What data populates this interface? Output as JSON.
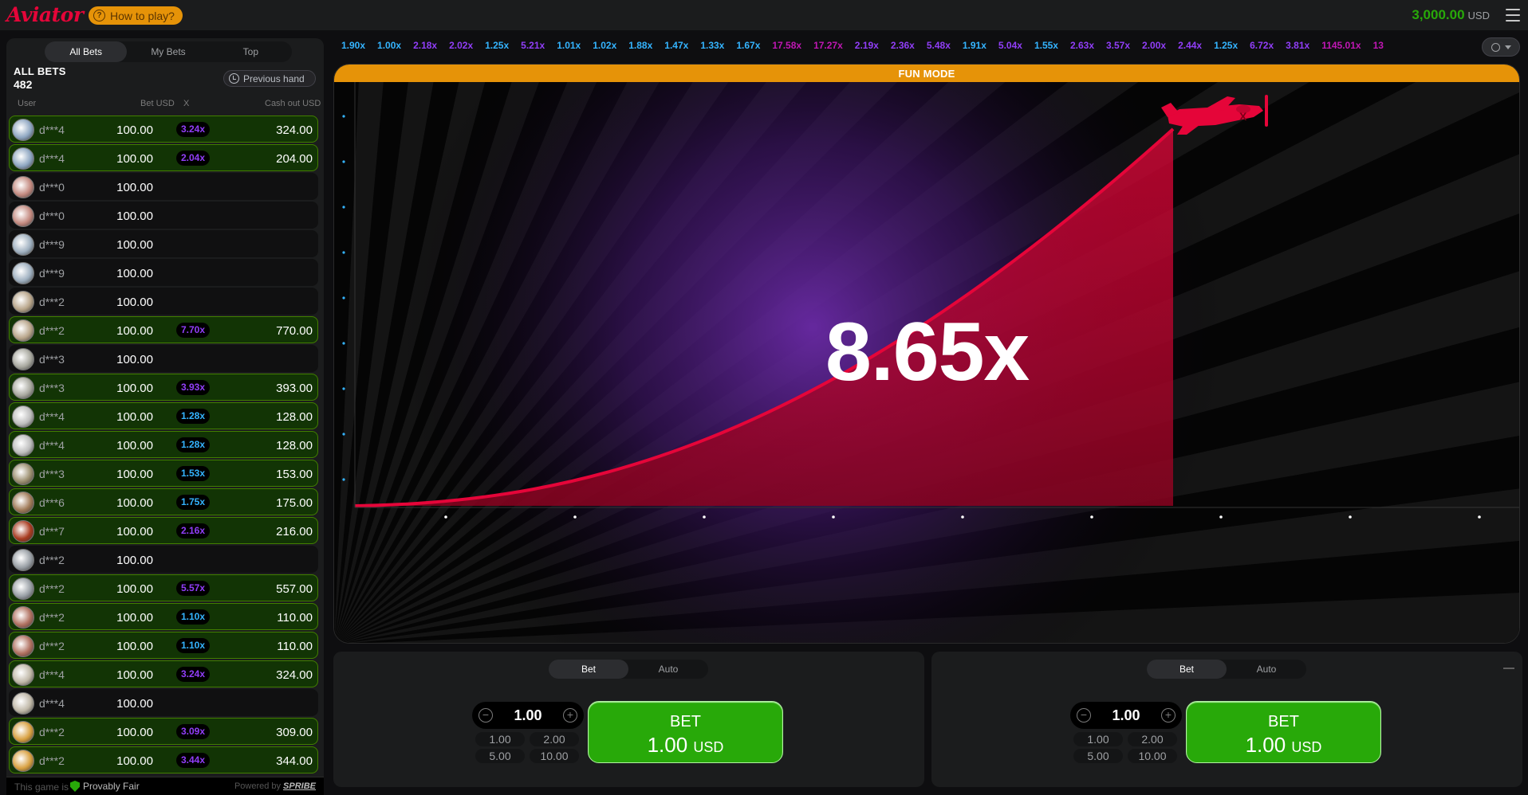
{
  "header": {
    "logo": "Aviator",
    "how_to_play": "How to play?",
    "balance_amount": "3,000.00",
    "balance_currency": "USD"
  },
  "left_panel": {
    "tabs": [
      "All Bets",
      "My Bets",
      "Top"
    ],
    "active_tab": 0,
    "title": "ALL BETS",
    "count": "482",
    "previous_hand": "Previous hand",
    "columns": {
      "user": "User",
      "bet": "Bet USD",
      "x": "X",
      "cashout": "Cash out USD"
    },
    "rows": [
      {
        "user": "d***4",
        "bet": "100.00",
        "mult": "3.24x",
        "mult_color": "purple",
        "cashout": "324.00",
        "avatar": "#8fa7c2"
      },
      {
        "user": "d***4",
        "bet": "100.00",
        "mult": "2.04x",
        "mult_color": "purple",
        "cashout": "204.00",
        "avatar": "#8fa7c2"
      },
      {
        "user": "d***0",
        "bet": "100.00",
        "mult": "",
        "mult_color": "",
        "cashout": "",
        "avatar": "#c48a80"
      },
      {
        "user": "d***0",
        "bet": "100.00",
        "mult": "",
        "mult_color": "",
        "cashout": "",
        "avatar": "#c48a80"
      },
      {
        "user": "d***9",
        "bet": "100.00",
        "mult": "",
        "mult_color": "",
        "cashout": "",
        "avatar": "#9fb0c0"
      },
      {
        "user": "d***9",
        "bet": "100.00",
        "mult": "",
        "mult_color": "",
        "cashout": "",
        "avatar": "#9fb0c0"
      },
      {
        "user": "d***2",
        "bet": "100.00",
        "mult": "",
        "mult_color": "",
        "cashout": "",
        "avatar": "#b8a58a"
      },
      {
        "user": "d***2",
        "bet": "100.00",
        "mult": "7.70x",
        "mult_color": "purple",
        "cashout": "770.00",
        "avatar": "#b8a58a"
      },
      {
        "user": "d***3",
        "bet": "100.00",
        "mult": "",
        "mult_color": "",
        "cashout": "",
        "avatar": "#a9a9a0"
      },
      {
        "user": "d***3",
        "bet": "100.00",
        "mult": "3.93x",
        "mult_color": "purple",
        "cashout": "393.00",
        "avatar": "#a9a9a0"
      },
      {
        "user": "d***4",
        "bet": "100.00",
        "mult": "1.28x",
        "mult_color": "blue",
        "cashout": "128.00",
        "avatar": "#bdbdbd"
      },
      {
        "user": "d***4",
        "bet": "100.00",
        "mult": "1.28x",
        "mult_color": "blue",
        "cashout": "128.00",
        "avatar": "#bdbdbd"
      },
      {
        "user": "d***3",
        "bet": "100.00",
        "mult": "1.53x",
        "mult_color": "blue",
        "cashout": "153.00",
        "avatar": "#9c8f70"
      },
      {
        "user": "d***6",
        "bet": "100.00",
        "mult": "1.75x",
        "mult_color": "blue",
        "cashout": "175.00",
        "avatar": "#a07a58"
      },
      {
        "user": "d***7",
        "bet": "100.00",
        "mult": "2.16x",
        "mult_color": "purple",
        "cashout": "216.00",
        "avatar": "#a83a1f"
      },
      {
        "user": "d***2",
        "bet": "100.00",
        "mult": "",
        "mult_color": "",
        "cashout": "",
        "avatar": "#9aa0a6"
      },
      {
        "user": "d***2",
        "bet": "100.00",
        "mult": "5.57x",
        "mult_color": "purple",
        "cashout": "557.00",
        "avatar": "#9aa0a6"
      },
      {
        "user": "d***2",
        "bet": "100.00",
        "mult": "1.10x",
        "mult_color": "blue",
        "cashout": "110.00",
        "avatar": "#b07060"
      },
      {
        "user": "d***2",
        "bet": "100.00",
        "mult": "1.10x",
        "mult_color": "blue",
        "cashout": "110.00",
        "avatar": "#b07060"
      },
      {
        "user": "d***4",
        "bet": "100.00",
        "mult": "3.24x",
        "mult_color": "purple",
        "cashout": "324.00",
        "avatar": "#c0b8a8"
      },
      {
        "user": "d***4",
        "bet": "100.00",
        "mult": "",
        "mult_color": "",
        "cashout": "",
        "avatar": "#c0b8a8"
      },
      {
        "user": "d***2",
        "bet": "100.00",
        "mult": "3.09x",
        "mult_color": "purple",
        "cashout": "309.00",
        "avatar": "#d8a040"
      },
      {
        "user": "d***2",
        "bet": "100.00",
        "mult": "3.44x",
        "mult_color": "purple",
        "cashout": "344.00",
        "avatar": "#d8a040"
      }
    ],
    "footer": {
      "this_game_is": "This game is",
      "provably_fair": "Provably Fair",
      "powered_by": "Powered by",
      "brand": "SPRIBE"
    }
  },
  "history": [
    {
      "v": "1.90x",
      "c": "blue"
    },
    {
      "v": "1.00x",
      "c": "blue"
    },
    {
      "v": "2.18x",
      "c": "purple"
    },
    {
      "v": "2.02x",
      "c": "purple"
    },
    {
      "v": "1.25x",
      "c": "blue"
    },
    {
      "v": "5.21x",
      "c": "purple"
    },
    {
      "v": "1.01x",
      "c": "blue"
    },
    {
      "v": "1.02x",
      "c": "blue"
    },
    {
      "v": "1.88x",
      "c": "blue"
    },
    {
      "v": "1.47x",
      "c": "blue"
    },
    {
      "v": "1.33x",
      "c": "blue"
    },
    {
      "v": "1.67x",
      "c": "blue"
    },
    {
      "v": "17.58x",
      "c": "pink"
    },
    {
      "v": "17.27x",
      "c": "pink"
    },
    {
      "v": "2.19x",
      "c": "purple"
    },
    {
      "v": "2.36x",
      "c": "purple"
    },
    {
      "v": "5.48x",
      "c": "purple"
    },
    {
      "v": "1.91x",
      "c": "blue"
    },
    {
      "v": "5.04x",
      "c": "purple"
    },
    {
      "v": "1.55x",
      "c": "blue"
    },
    {
      "v": "2.63x",
      "c": "purple"
    },
    {
      "v": "3.57x",
      "c": "purple"
    },
    {
      "v": "2.00x",
      "c": "purple"
    },
    {
      "v": "2.44x",
      "c": "purple"
    },
    {
      "v": "1.25x",
      "c": "blue"
    },
    {
      "v": "6.72x",
      "c": "purple"
    },
    {
      "v": "3.81x",
      "c": "purple"
    },
    {
      "v": "1145.01x",
      "c": "pink"
    },
    {
      "v": "13",
      "c": "pink"
    }
  ],
  "game": {
    "mode_banner": "FUN MODE",
    "multiplier": "8.65x",
    "colors": {
      "curve": "#e50539",
      "accent": "#e69308",
      "win": "#28a909"
    }
  },
  "bet_panels": [
    {
      "tabs": [
        "Bet",
        "Auto"
      ],
      "amount": "1.00",
      "quick": [
        "1.00",
        "2.00",
        "5.00",
        "10.00"
      ],
      "button_line1": "BET",
      "button_amount": "1.00",
      "button_currency": "USD"
    },
    {
      "tabs": [
        "Bet",
        "Auto"
      ],
      "amount": "1.00",
      "quick": [
        "1.00",
        "2.00",
        "5.00",
        "10.00"
      ],
      "button_line1": "BET",
      "button_amount": "1.00",
      "button_currency": "USD"
    }
  ]
}
